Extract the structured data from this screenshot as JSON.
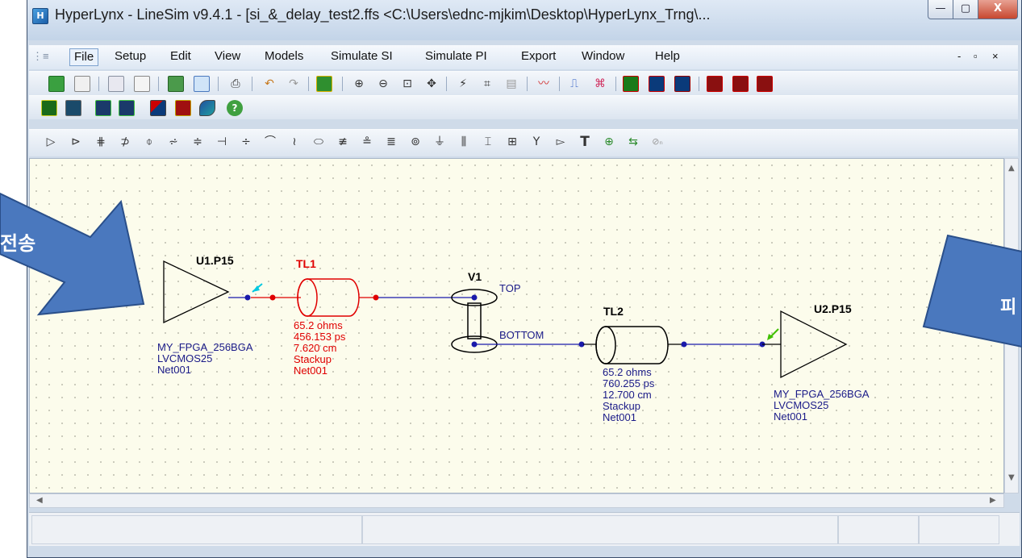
{
  "window": {
    "title": "HyperLynx - LineSim v9.4.1 - [si_&_delay_test2.ffs <C:\\Users\\ednc-mjkim\\Desktop\\HyperLynx_Trng\\...",
    "min_label": "—",
    "max_label": "▢",
    "close_label": "X"
  },
  "menu": {
    "items": [
      "File",
      "Setup",
      "Edit",
      "View",
      "Models",
      "Simulate SI",
      "Simulate PI",
      "Export",
      "Window",
      "Help"
    ],
    "mdi_min": "-",
    "mdi_restore": "▫",
    "mdi_close": "×"
  },
  "schematic": {
    "driver": {
      "ref": "U1.P15",
      "model": "MY_FPGA_256BGA",
      "standard": "LVCMOS25",
      "net": "Net001"
    },
    "tl1": {
      "ref": "TL1",
      "impedance": "65.2 ohms",
      "delay": "456.153 ps",
      "length": "7.620 cm",
      "type": "Stackup",
      "net": "Net001",
      "color": "#e00000"
    },
    "via": {
      "ref": "V1",
      "top_layer": "TOP",
      "bottom_layer": "BOTTOM"
    },
    "tl2": {
      "ref": "TL2",
      "impedance": "65.2 ohms",
      "delay": "760.255 ps",
      "length": "12.700 cm",
      "type": "Stackup",
      "net": "Net001"
    },
    "receiver": {
      "ref": "U2.P15",
      "model": "MY_FPGA_256BGA",
      "standard": "LVCMOS25",
      "net": "Net001"
    },
    "wire_color": "#1a1aaa",
    "label_color": "#1a1a88"
  },
  "annotations": {
    "left_arrow_text": "전송",
    "right_arrow_text": "피",
    "arrow_color": "#4a78be"
  }
}
